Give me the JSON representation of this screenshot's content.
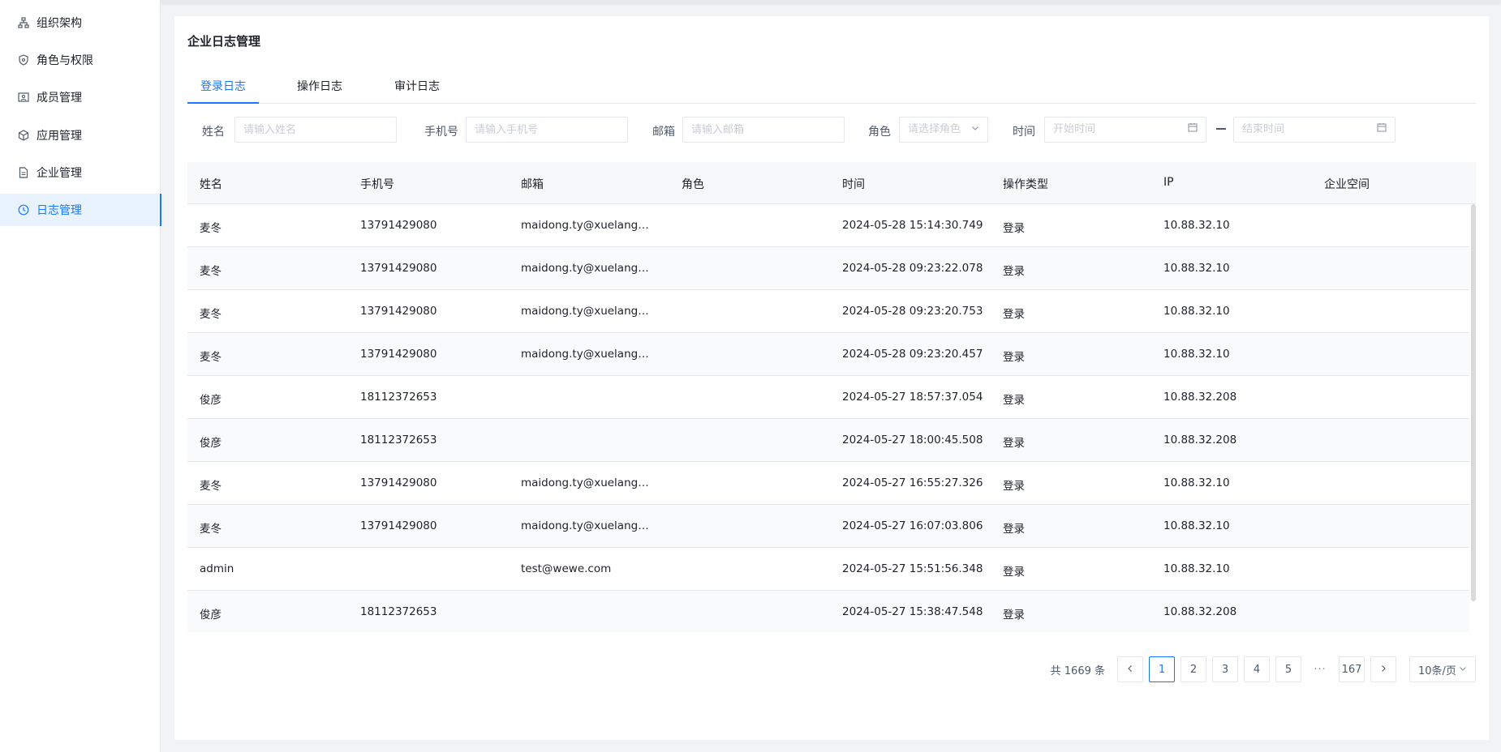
{
  "sidebar": {
    "items": [
      {
        "label": "组织架构",
        "icon": "org-icon"
      },
      {
        "label": "角色与权限",
        "icon": "shield-icon"
      },
      {
        "label": "成员管理",
        "icon": "member-icon"
      },
      {
        "label": "应用管理",
        "icon": "cube-icon"
      },
      {
        "label": "企业管理",
        "icon": "document-icon"
      },
      {
        "label": "日志管理",
        "icon": "clock-icon"
      }
    ],
    "active": "日志管理"
  },
  "page": {
    "title": "企业日志管理",
    "tabs": [
      "登录日志",
      "操作日志",
      "审计日志"
    ],
    "active_tab": "登录日志"
  },
  "filters": {
    "name_label": "姓名",
    "name_placeholder": "请输入姓名",
    "phone_label": "手机号",
    "phone_placeholder": "请输入手机号",
    "email_label": "邮箱",
    "email_placeholder": "请输入邮箱",
    "role_label": "角色",
    "role_placeholder": "请选择角色",
    "time_label": "时间",
    "start_placeholder": "开始时间",
    "end_placeholder": "结束时间"
  },
  "table": {
    "columns": [
      "姓名",
      "手机号",
      "邮箱",
      "角色",
      "时间",
      "操作类型",
      "IP",
      "企业空间"
    ],
    "rows": [
      {
        "name": "麦冬",
        "phone": "13791429080",
        "email": "maidong.ty@xuelangyu...",
        "role": "",
        "time": "2024-05-28 15:14:30.749",
        "type": "登录",
        "ip": "10.88.32.10",
        "space": ""
      },
      {
        "name": "麦冬",
        "phone": "13791429080",
        "email": "maidong.ty@xuelangyu...",
        "role": "",
        "time": "2024-05-28 09:23:22.078",
        "type": "登录",
        "ip": "10.88.32.10",
        "space": ""
      },
      {
        "name": "麦冬",
        "phone": "13791429080",
        "email": "maidong.ty@xuelangyu...",
        "role": "",
        "time": "2024-05-28 09:23:20.753",
        "type": "登录",
        "ip": "10.88.32.10",
        "space": ""
      },
      {
        "name": "麦冬",
        "phone": "13791429080",
        "email": "maidong.ty@xuelangyu...",
        "role": "",
        "time": "2024-05-28 09:23:20.457",
        "type": "登录",
        "ip": "10.88.32.10",
        "space": ""
      },
      {
        "name": "俊彦",
        "phone": "18112372653",
        "email": "",
        "role": "",
        "time": "2024-05-27 18:57:37.054",
        "type": "登录",
        "ip": "10.88.32.208",
        "space": ""
      },
      {
        "name": "俊彦",
        "phone": "18112372653",
        "email": "",
        "role": "",
        "time": "2024-05-27 18:00:45.508",
        "type": "登录",
        "ip": "10.88.32.208",
        "space": ""
      },
      {
        "name": "麦冬",
        "phone": "13791429080",
        "email": "maidong.ty@xuelangyu...",
        "role": "",
        "time": "2024-05-27 16:55:27.326",
        "type": "登录",
        "ip": "10.88.32.10",
        "space": ""
      },
      {
        "name": "麦冬",
        "phone": "13791429080",
        "email": "maidong.ty@xuelangyu...",
        "role": "",
        "time": "2024-05-27 16:07:03.806",
        "type": "登录",
        "ip": "10.88.32.10",
        "space": ""
      },
      {
        "name": "admin",
        "phone": "",
        "email": "test@wewe.com",
        "role": "",
        "time": "2024-05-27 15:51:56.348",
        "type": "登录",
        "ip": "10.88.32.10",
        "space": ""
      },
      {
        "name": "俊彦",
        "phone": "18112372653",
        "email": "",
        "role": "",
        "time": "2024-05-27 15:38:47.548",
        "type": "登录",
        "ip": "10.88.32.208",
        "space": ""
      }
    ]
  },
  "pagination": {
    "total": "共 1669 条",
    "prev": "<",
    "pages": [
      "1",
      "2",
      "3",
      "4",
      "5"
    ],
    "current": "1",
    "dots": "···",
    "last": "167",
    "next": ">",
    "page_size": "10条/页"
  }
}
